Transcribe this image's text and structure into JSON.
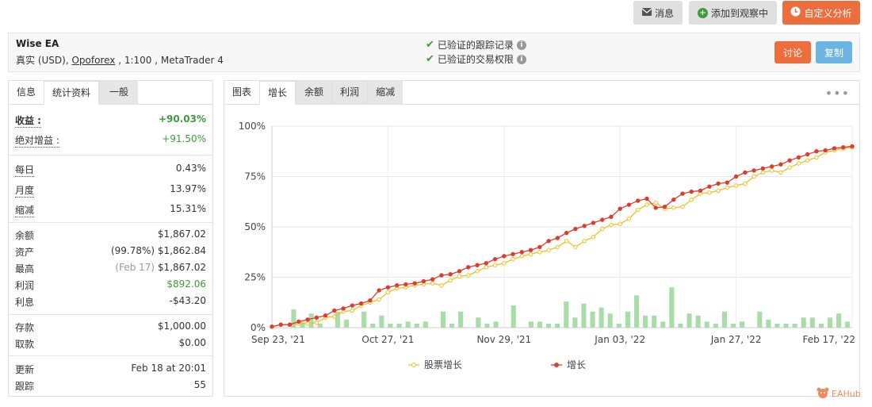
{
  "toolbar": {
    "messages_label": "消息",
    "watch_label": "添加到观察中",
    "analysis_label": "自定义分析"
  },
  "header": {
    "ea_name": "Wise EA",
    "account_prefix": "真实 (USD),",
    "broker": "Opoforex",
    "account_suffix": ", 1:100 , MetaTrader 4",
    "verify_track": "已验证的跟踪记录",
    "verify_trade": "已验证的交易权限",
    "discuss_label": "讨论",
    "copy_label": "复制"
  },
  "left_tabs": [
    "信息",
    "统计资料",
    "一般"
  ],
  "stats": {
    "gain_label": "收益 :",
    "gain_value": "+90.03%",
    "abs_gain_label": "绝对增益 :",
    "abs_gain_value": "+91.50%",
    "daily_label": "每日",
    "daily_value": "0.43%",
    "monthly_label": "月度",
    "monthly_value": "13.97%",
    "drawdown_label": "缩减",
    "drawdown_value": "15.31%",
    "balance_label": "余额",
    "balance_value": "$1,867.02",
    "equity_label": "资产",
    "equity_pct": "(99.78%)",
    "equity_value": "$1,862.84",
    "highest_label": "最高",
    "highest_date": "(Feb 17)",
    "highest_value": "$1,867.02",
    "profit_label": "利润",
    "profit_value": "$892.06",
    "interest_label": "利息",
    "interest_value": "-$43.20",
    "deposits_label": "存款",
    "deposits_value": "$1,000.00",
    "withdrawals_label": "取款",
    "withdrawals_value": "$0.00",
    "updated_label": "更新",
    "updated_value": "Feb 18 at 20:01",
    "tracking_label": "跟踪",
    "tracking_value": "55"
  },
  "right_tabs": [
    "图表",
    "增长",
    "余额",
    "利润",
    "缩减"
  ],
  "more_icon": "ellipsis-icon",
  "watermark": "EAHub",
  "colors": {
    "growth": "#e03c2c",
    "equity_growth": "#f0c020",
    "bars": "#a8dca8",
    "accent_orange": "#ee6d3d",
    "accent_blue": "#6cb4e4"
  },
  "chart_data": {
    "type": "line",
    "x_ticks": [
      "Sep 23, '21",
      "Oct 27, '21",
      "Nov 29, '21",
      "Jan 03, '22",
      "Jan 27, '22",
      "Feb 17, '22"
    ],
    "y_ticks": [
      "100%",
      "75%",
      "50%",
      "25%",
      "0%"
    ],
    "ylim": [
      0,
      100
    ],
    "series": [
      {
        "name": "股票增长",
        "values": [
          0.5,
          1.5,
          1.5,
          2,
          2,
          2.5,
          5,
          5.5,
          8,
          8.5,
          11,
          12.5,
          14,
          17.5,
          19.5,
          20,
          21,
          21.5,
          22,
          21,
          23.5,
          25.5,
          26,
          28,
          30,
          31,
          32,
          34,
          35.5,
          36.5,
          37.5,
          38.5,
          40,
          43,
          40,
          43,
          45,
          49,
          51,
          51.5,
          54,
          58.5,
          61,
          62,
          59,
          59.5,
          60,
          63.5,
          66.5,
          67,
          68,
          69.5,
          70.5,
          71.5,
          75,
          77,
          78,
          77,
          79.5,
          81.5,
          83,
          84.5,
          87,
          88,
          89,
          89.5
        ]
      },
      {
        "name": "增长",
        "values": [
          0.5,
          1.5,
          1.5,
          3,
          4,
          5,
          6,
          8.5,
          9.5,
          11,
          12,
          13.5,
          18.5,
          20,
          21,
          21.5,
          22,
          23,
          24,
          26,
          26.5,
          28,
          30,
          31,
          32,
          34,
          35.5,
          36.5,
          37.5,
          38.5,
          40,
          43,
          44.5,
          47,
          49,
          50.5,
          52,
          53.5,
          55,
          59,
          61,
          63,
          64,
          59.5,
          60,
          63.5,
          66.5,
          67.5,
          68,
          70,
          71.5,
          72,
          75,
          77,
          78,
          79,
          80,
          81,
          83,
          84.5,
          86,
          87.5,
          88,
          89,
          89.5,
          90
        ]
      }
    ],
    "bars": [
      0,
      0,
      9,
      3,
      7,
      2,
      0,
      8,
      4,
      0,
      8,
      2,
      6,
      2,
      2,
      3,
      2,
      3,
      0,
      8,
      2,
      8,
      0,
      5,
      2,
      3,
      0,
      11,
      0,
      3,
      3,
      2,
      2,
      13,
      5,
      12,
      8,
      10,
      7,
      2,
      8,
      16,
      6,
      6,
      3,
      20,
      2,
      7,
      6,
      3,
      2,
      8,
      2,
      3,
      0,
      8,
      4,
      2,
      2,
      2,
      5,
      5,
      2,
      5,
      7,
      3
    ]
  }
}
